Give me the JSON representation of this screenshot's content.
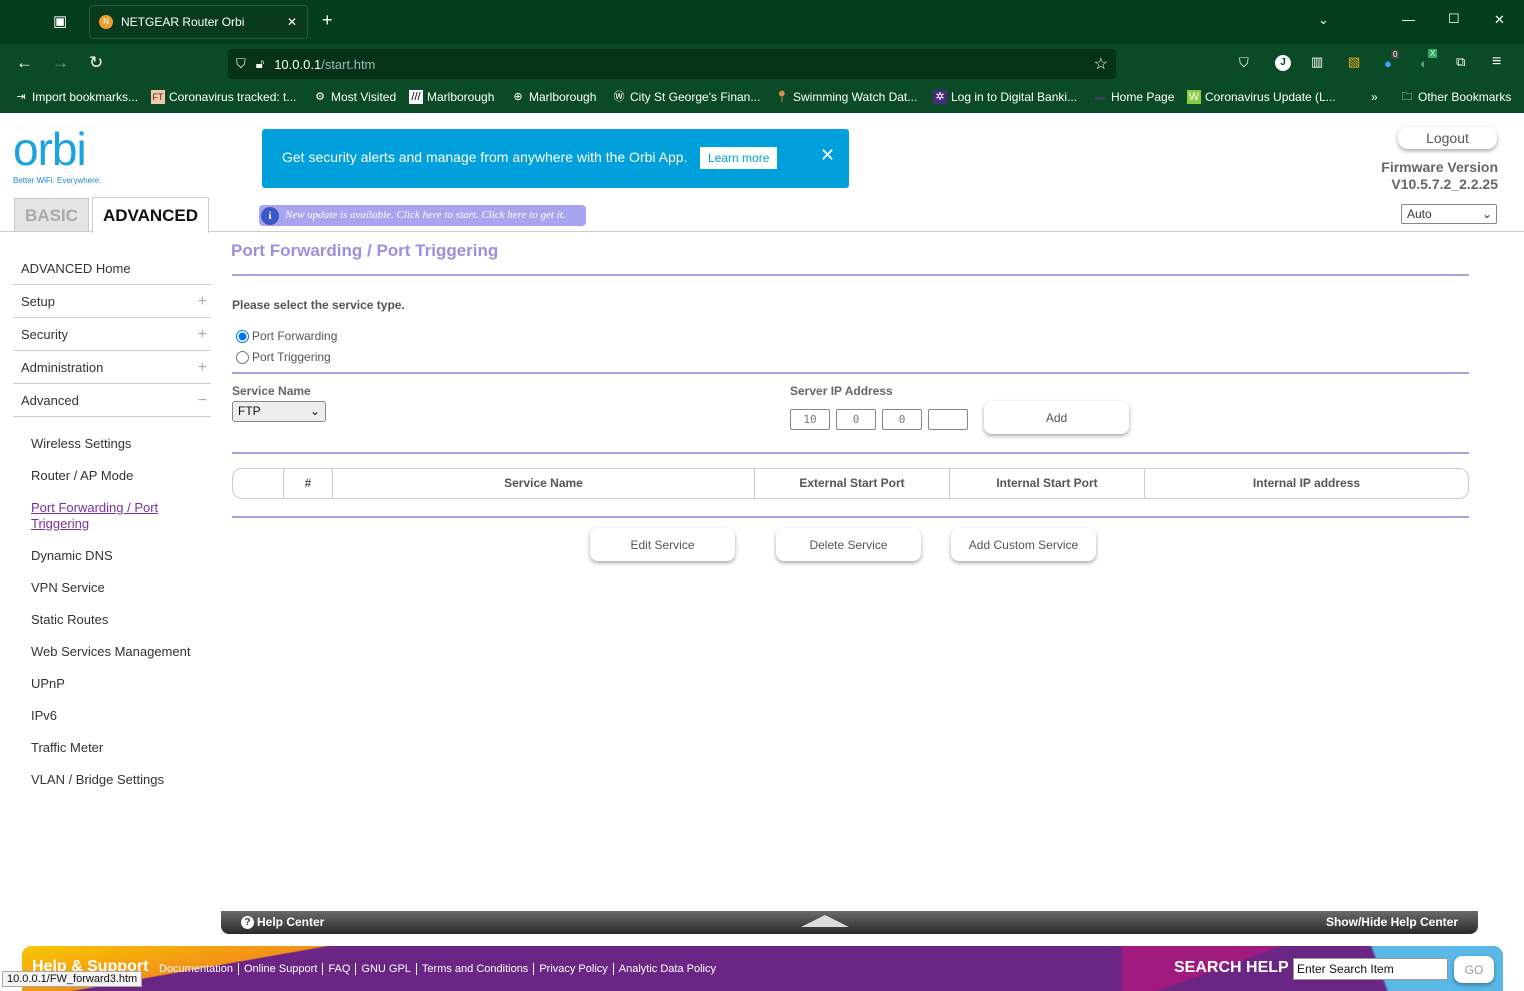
{
  "browser": {
    "tab_title": "NETGEAR Router Orbi",
    "url_host": "10.0.0.1",
    "url_path": "/start.htm",
    "bookmarks": [
      "Import bookmarks...",
      "Coronavirus tracked: t...",
      "Most Visited",
      "Marlborough",
      "Marlborough",
      "City St George's Finan...",
      "Swimming Watch Dat...",
      "Log in to Digital Banki...",
      "Home Page",
      "Coronavirus Update (L..."
    ],
    "other_bookmarks": "Other Bookmarks",
    "ext_badge": "0",
    "ext_badge2": "X",
    "profile_letter": "J"
  },
  "header": {
    "logo": "orbi",
    "tagline": "Better WiFi. Everywhere.",
    "banner_text": "Get security alerts and manage from anywhere with the Orbi App.",
    "learn_more": "Learn more",
    "update_notice": "New update is available. Click here to start. Click here to get it.",
    "logout": "Logout",
    "firmware_label": "Firmware Version",
    "firmware_version": "V10.5.7.2_2.2.25",
    "language": "Auto",
    "tabs": [
      "BASIC",
      "ADVANCED"
    ]
  },
  "sidebar": {
    "items": [
      {
        "label": "ADVANCED Home"
      },
      {
        "label": "Setup",
        "toggle": "+"
      },
      {
        "label": "Security",
        "toggle": "+"
      },
      {
        "label": "Administration",
        "toggle": "+"
      },
      {
        "label": "Advanced",
        "toggle": "−"
      }
    ],
    "sub_items": [
      "Wireless Settings",
      "Router / AP Mode",
      "Port Forwarding / Port Triggering",
      "Dynamic DNS",
      "VPN Service",
      "Static Routes",
      "Web Services Management",
      "UPnP",
      "IPv6",
      "Traffic Meter",
      "VLAN / Bridge Settings"
    ]
  },
  "main": {
    "title": "Port Forwarding / Port Triggering",
    "prompt": "Please select the service type.",
    "radio_forwarding": "Port Forwarding",
    "radio_triggering": "Port Triggering",
    "service_name_label": "Service Name",
    "service_name_value": "FTP",
    "server_ip_label": "Server IP Address",
    "ip": [
      "10",
      "0",
      "0",
      ""
    ],
    "add": "Add",
    "columns": [
      "",
      "#",
      "Service Name",
      "External Start Port",
      "Internal Start Port",
      "Internal IP address"
    ],
    "edit": "Edit Service",
    "delete": "Delete Service",
    "add_custom": "Add Custom Service"
  },
  "help": {
    "help_center": "Help Center",
    "show_hide": "Show/Hide Help Center",
    "support_title": "Help & Support",
    "links": [
      "Documentation",
      "Online Support",
      "FAQ",
      "GNU GPL",
      "Terms and Conditions",
      "Privacy Policy",
      "Analytic Data Policy"
    ],
    "search_label": "SEARCH HELP",
    "search_placeholder": "Enter Search Item",
    "go": "GO"
  },
  "status_url": "10.0.0.1/FW_forward3.htm"
}
